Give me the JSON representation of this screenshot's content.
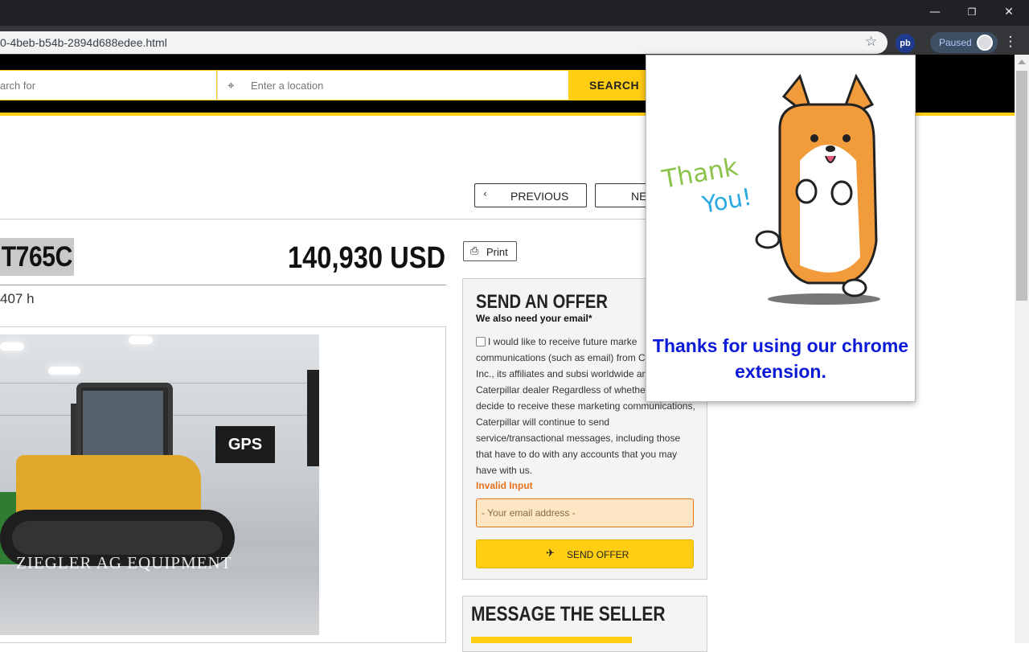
{
  "browser": {
    "url": "0-4beb-b54b-2894d688edee.html",
    "extension_badge": "pb",
    "profile_status": "Paused",
    "window_controls": [
      "—",
      "❐",
      "✕"
    ]
  },
  "header": {
    "search_placeholder": "arch for",
    "location_placeholder": "Enter a location",
    "search_button": "SEARCH"
  },
  "listing_nav": {
    "previous": "PREVIOUS",
    "next": "NE"
  },
  "listing": {
    "model": "T765C",
    "price": "140,930 USD",
    "hours": "407 h",
    "photo": {
      "sign_text": "GPS",
      "watermark": "ZIEGLER AG EQUIPMENT"
    }
  },
  "print_button": "Print",
  "send_offer": {
    "title": "SEND AN OFFER",
    "subtitle": "We also need your email*",
    "consent_text": "I would like to receive future marke communications (such as email) from Caterpillar Inc., its affiliates and subsi worldwide and the Caterpillar dealer Regardless of whether you decide to receive these marketing communications, Caterpillar will continue to send service/transactional messages, including those that have to do with any accounts that you may have with us.",
    "error": "Invalid Input",
    "email_placeholder": "- Your email address -",
    "submit": "SEND OFFER"
  },
  "message_seller": {
    "title": "MESSAGE THE SELLER"
  },
  "extension_popup": {
    "thank": "Thank",
    "you": "You!",
    "message": "Thanks for using our chrome extension."
  },
  "colors": {
    "brand_yellow": "#ffcd11",
    "error_orange": "#e8731d",
    "popup_text_blue": "#0b1ad6"
  }
}
